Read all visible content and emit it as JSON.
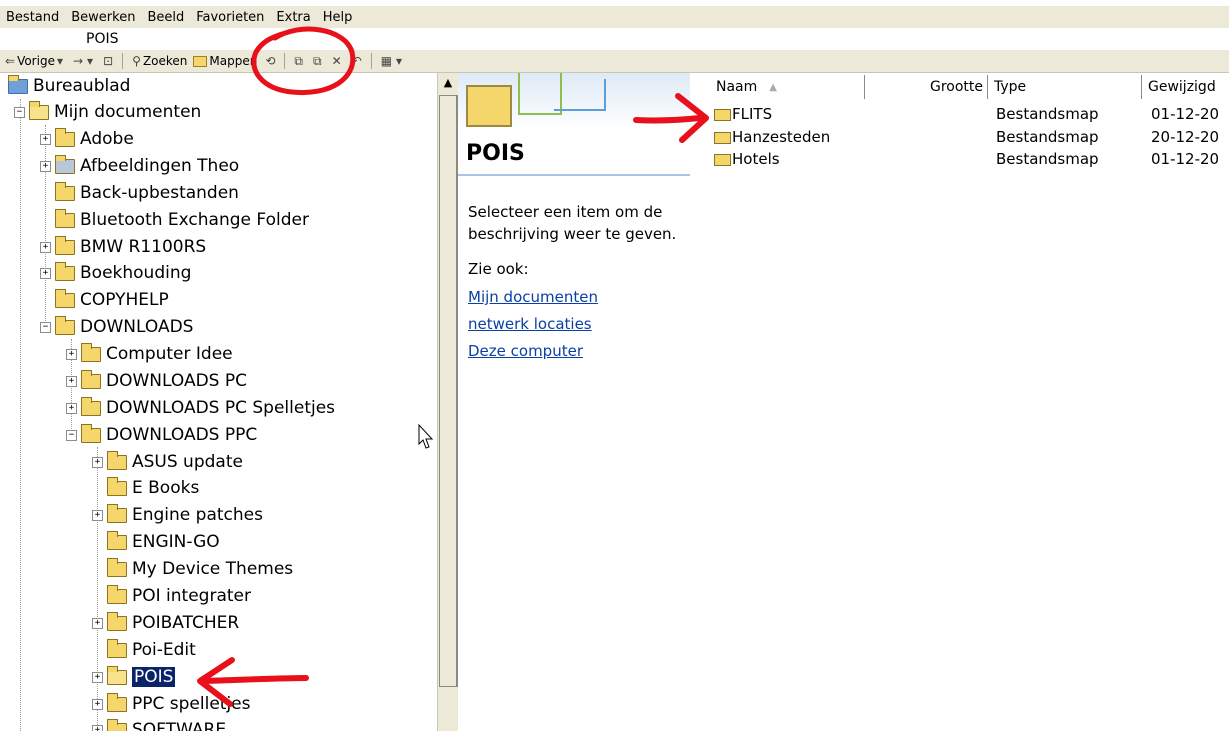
{
  "menu": [
    "Bestand",
    "Bewerken",
    "Beeld",
    "Favorieten",
    "Extra",
    "Help"
  ],
  "address": {
    "value": "POIS"
  },
  "toolbar": {
    "back_label": "Vorige",
    "search_label": "Zoeken",
    "folders_label": "Mappen"
  },
  "tree": {
    "desktop": "Bureaublad",
    "my_documents": "Mijn documenten",
    "items": [
      "Adobe",
      "Afbeeldingen Theo",
      "Back-upbestanden",
      "Bluetooth Exchange Folder",
      "BMW R1100RS",
      "Boekhouding",
      "COPYHELP",
      "DOWNLOADS"
    ],
    "downloads_children": [
      "Computer Idee",
      "DOWNLOADS PC",
      "DOWNLOADS PC Spelletjes",
      "DOWNLOADS PPC"
    ],
    "ppc_children": [
      "ASUS update",
      "E Books",
      "Engine patches",
      "ENGIN-GO",
      "My Device Themes",
      "POI integrater",
      "POIBATCHER",
      "Poi-Edit",
      "POIS",
      "PPC spelletjes",
      "SOFTWARE"
    ]
  },
  "taskpane": {
    "title": "POIS",
    "description": "Selecteer een item om de beschrijving weer te geven.",
    "see_also": "Zie ook:",
    "links": [
      "Mijn documenten",
      "netwerk locaties",
      "Deze computer"
    ]
  },
  "filelist": {
    "columns": [
      "Naam",
      "Grootte",
      "Type",
      "Gewijzigd"
    ],
    "rows": [
      {
        "name": "FLITS",
        "type": "Bestandsmap",
        "modified": "01-12-20"
      },
      {
        "name": "Hanzesteden",
        "type": "Bestandsmap",
        "modified": "20-12-20"
      },
      {
        "name": "Hotels",
        "type": "Bestandsmap",
        "modified": "01-12-20"
      }
    ]
  },
  "colors": {
    "chrome": "#ece9d8",
    "selection": "#0a246a",
    "folder": "#f4d66a",
    "link": "#0a3fa8",
    "annotation": "#e8101a"
  }
}
